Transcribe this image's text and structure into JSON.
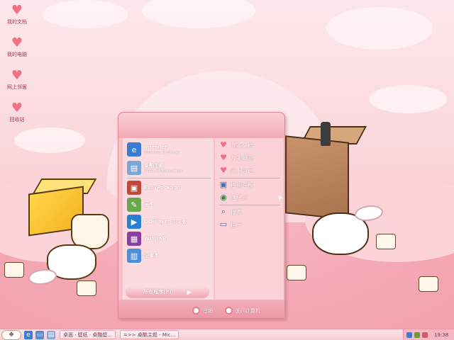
{
  "desktop": {
    "icons": [
      {
        "label": "我的文档",
        "icon": "heart-icon"
      },
      {
        "label": "我的电脑",
        "icon": "heart-icon"
      },
      {
        "label": "网上邻居",
        "icon": "heart-icon"
      },
      {
        "label": "回收站",
        "icon": "heart-icon"
      }
    ]
  },
  "start_menu": {
    "pinned": [
      {
        "title": "Internet",
        "subtitle": "Internet Explorer",
        "icon": "ie-icon",
        "color": "#3a7bd5"
      },
      {
        "title": "桌酷主题",
        "subtitle": "Desk.ZhuoKu.Com",
        "icon": "browser-window-icon",
        "color": "#7aa6d8"
      }
    ],
    "recent": [
      {
        "label": "EasyPackage",
        "icon": "package-icon",
        "color": "#c04a3a"
      },
      {
        "label": "画图",
        "icon": "paint-icon",
        "color": "#6aa84f"
      },
      {
        "label": "QQPlayer 中文版",
        "icon": "media-player-icon",
        "color": "#2a7fd0"
      },
      {
        "label": "WinRAR",
        "icon": "winrar-icon",
        "color": "#8a3fa0"
      },
      {
        "label": "记事本",
        "icon": "notepad-icon",
        "color": "#4a90d9"
      }
    ],
    "all_programs": "所有程序(P)",
    "right": [
      {
        "label": "我的文档",
        "icon": "heart-icon",
        "arrow": false
      },
      {
        "label": "我的电脑",
        "icon": "heart-icon",
        "arrow": false
      },
      {
        "label": "网上邻居",
        "icon": "heart-icon",
        "arrow": false
      },
      {
        "label": "控制面板",
        "icon": "control-panel-icon",
        "arrow": false
      },
      {
        "label": "连接到",
        "icon": "globe-icon",
        "arrow": true
      },
      {
        "label": "搜索",
        "icon": "search-icon",
        "arrow": false
      },
      {
        "label": "运行",
        "icon": "run-icon",
        "arrow": false
      }
    ],
    "logoff": "注销",
    "shutdown": "关闭计算机"
  },
  "taskbar": {
    "tasks": [
      {
        "label": "桌面 · 壁纸 · 桌酷壁..."
      },
      {
        "label": "=>> 桌酷主题 - Mic..."
      }
    ],
    "clock": "19:38"
  },
  "colors": {
    "accent": "#f07088",
    "menu_bg": "#f6c1c7",
    "menu_border": "#e08a98"
  }
}
